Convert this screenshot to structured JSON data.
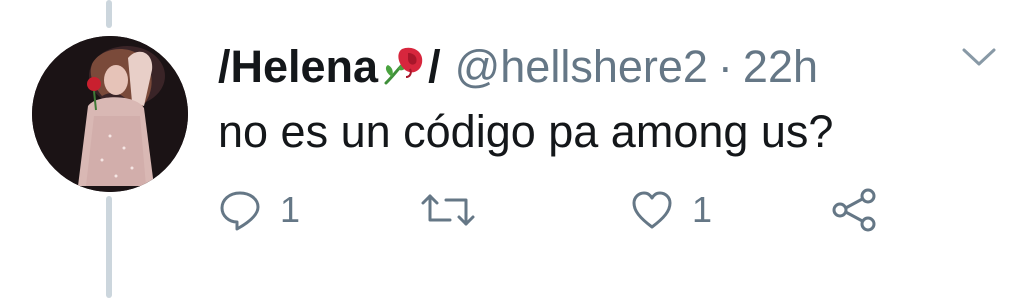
{
  "tweet": {
    "display_name": "/Helena",
    "name_emoji": "wilted-rose-icon",
    "name_suffix": "/",
    "handle": "@hellshere2",
    "separator": "·",
    "time": "22h",
    "text": "no es un código pa among us?"
  },
  "actions": {
    "reply": {
      "icon": "reply-icon",
      "count": "1"
    },
    "retweet": {
      "icon": "retweet-icon",
      "count": ""
    },
    "like": {
      "icon": "heart-icon",
      "count": "1"
    },
    "share": {
      "icon": "share-icon"
    }
  },
  "colors": {
    "text": "#14171a",
    "secondary": "#657786",
    "thread_line": "#ccd6dd",
    "rose_red": "#d7263d",
    "rose_stem": "#3f8f3a"
  }
}
